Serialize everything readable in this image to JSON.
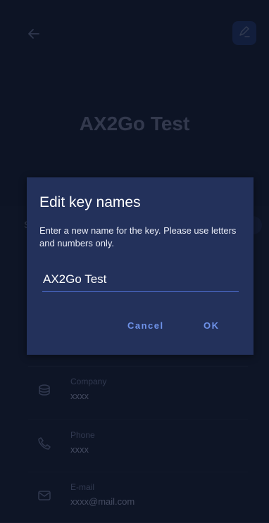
{
  "header": {
    "title": "AX2Go Test"
  },
  "card": {
    "left_letter": "S",
    "rows": [
      {
        "label": "Company",
        "value": "xxxx",
        "icon": "database-icon"
      },
      {
        "label": "Phone",
        "value": "xxxx",
        "icon": "phone-icon"
      },
      {
        "label": "E-mail",
        "value": "xxxx@mail.com",
        "icon": "mail-icon"
      }
    ]
  },
  "dialog": {
    "title": "Edit key names",
    "message": "Enter a new name for the key. Please use letters and numbers only.",
    "input_value": "AX2Go Test",
    "cancel_label": "Cancel",
    "ok_label": "OK"
  },
  "colors": {
    "background": "#121a30",
    "dialog": "#23315b",
    "accent": "#6f93ea",
    "input_underline": "#4f6fd4"
  }
}
